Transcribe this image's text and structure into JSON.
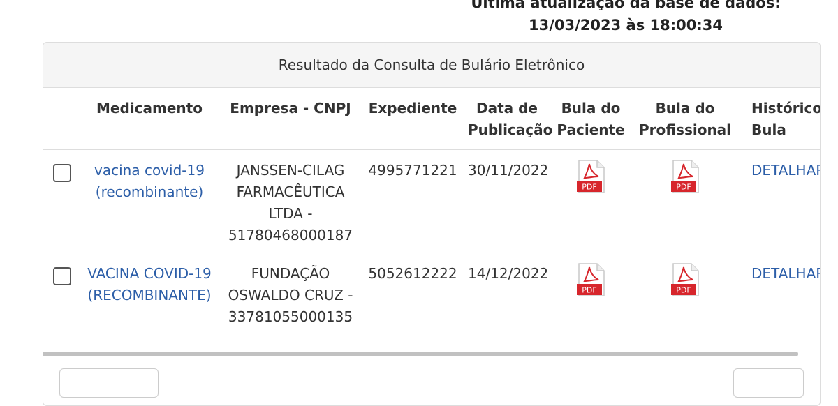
{
  "update_info": {
    "line1": "Última atualização da base de dados:",
    "line2": "13/03/2023 às 18:00:34"
  },
  "panel": {
    "title": "Resultado da Consulta de Bulário Eletrônico"
  },
  "table": {
    "headers": {
      "medicamento": "Medicamento",
      "empresa": "Empresa - CNPJ",
      "expediente": "Expediente",
      "data": "Data de Publicação",
      "bula_paciente": "Bula do Paciente",
      "bula_profissional": "Bula do Profissional",
      "historico": "Histórico de Bula"
    },
    "rows": [
      {
        "medicamento": "vacina covid-19 (recombinante)",
        "empresa": "JANSSEN-CILAG FARMACÊUTICA LTDA - 51780468000187",
        "expediente": "4995771221",
        "data": "30/11/2022",
        "bula_paciente_icon": "pdf-icon",
        "bula_profissional_icon": "pdf-icon",
        "historico": "DETALHAR"
      },
      {
        "medicamento": "VACINA COVID-19 (RECOMBINANTE)",
        "empresa": "FUNDAÇÃO OSWALDO CRUZ - 33781055000135",
        "expediente": "5052612222",
        "data": "14/12/2022",
        "bula_paciente_icon": "pdf-icon",
        "bula_profissional_icon": "pdf-icon",
        "historico": "DETALHAR"
      }
    ],
    "pdf_label": "PDF"
  },
  "colors": {
    "link": "#2c5ea8",
    "pdf_red": "#d7262c",
    "border": "#dddddd"
  }
}
